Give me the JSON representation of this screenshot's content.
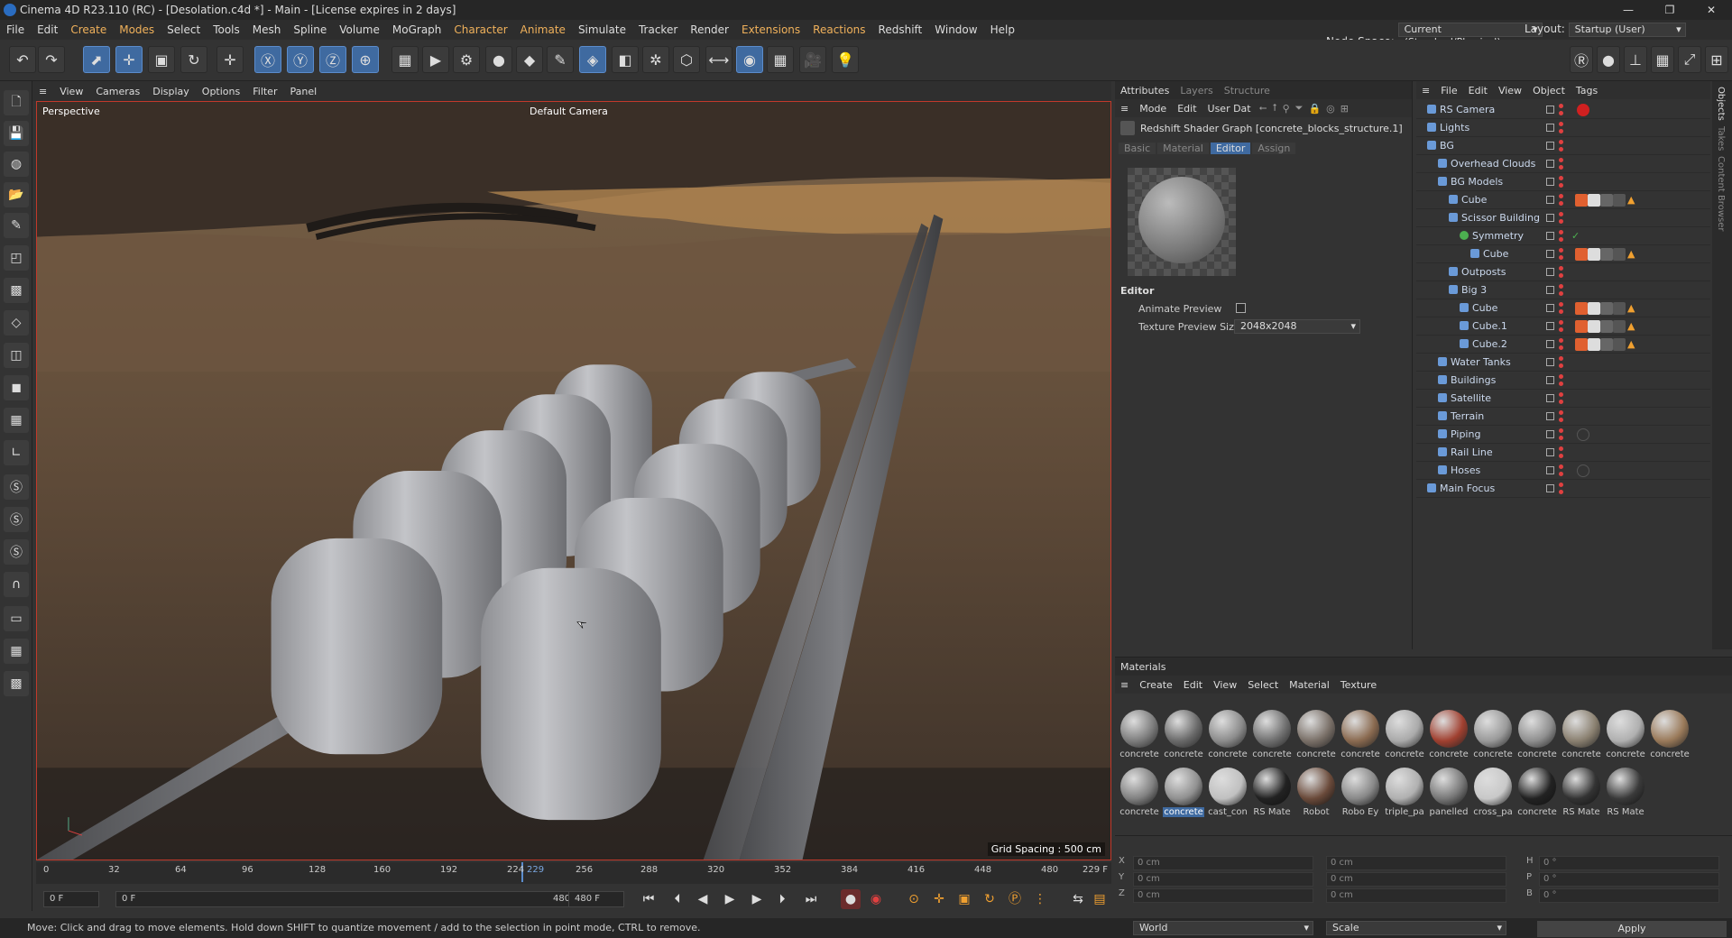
{
  "window": {
    "title": "Cinema 4D R23.110 (RC) - [Desolation.c4d *] - Main - [License expires in 2 days]",
    "min": "—",
    "max": "❐",
    "close": "✕"
  },
  "menu": [
    "File",
    "Edit",
    "Create",
    "Modes",
    "Select",
    "Tools",
    "Mesh",
    "Spline",
    "Volume",
    "MoGraph",
    "Character",
    "Animate",
    "Simulate",
    "Tracker",
    "Render",
    "Extensions",
    "Reactions",
    "Redshift",
    "Window",
    "Help"
  ],
  "nodespace": {
    "label": "Node Space:",
    "value": "Current (Standard/Physical)"
  },
  "layout": {
    "label": "Layout:",
    "value": "Startup (User)"
  },
  "viewport": {
    "menu": [
      "View",
      "Cameras",
      "Display",
      "Options",
      "Filter",
      "Panel"
    ],
    "label": "Perspective",
    "camera": "Default Camera",
    "grid": "Grid Spacing : 500 cm"
  },
  "timeline": {
    "ticks": [
      "0",
      "32",
      "64",
      "96",
      "128",
      "160",
      "192",
      "224",
      "229",
      "256",
      "288",
      "320",
      "352",
      "384",
      "416",
      "448",
      "480"
    ],
    "current": "229 F"
  },
  "transport": {
    "start": "0 F",
    "range_start": "0 F",
    "range_end": "480 F",
    "end": "480 F",
    "end2": "480 F"
  },
  "status": "Move: Click and drag to move elements. Hold down SHIFT to quantize movement / add to the selection in point mode, CTRL to remove.",
  "attributes": {
    "tabs": [
      "Attributes",
      "Layers",
      "Structure"
    ],
    "bar": [
      "Mode",
      "Edit",
      "User Dat"
    ],
    "title": "Redshift Shader Graph [concrete_blocks_structure.1]",
    "subtabs": [
      "Basic",
      "Material",
      "Editor",
      "Assign"
    ],
    "section": "Editor",
    "animate_label": "Animate Preview",
    "tex_label": "Texture Preview Size",
    "tex_value": "2048x2048"
  },
  "objects": {
    "menu": [
      "File",
      "Edit",
      "View",
      "Object",
      "Tags"
    ],
    "items": [
      {
        "name": "RS Camera",
        "depth": 0
      },
      {
        "name": "Lights",
        "depth": 0
      },
      {
        "name": "BG",
        "depth": 0
      },
      {
        "name": "Overhead Clouds",
        "depth": 1
      },
      {
        "name": "BG Models",
        "depth": 1
      },
      {
        "name": "Cube",
        "depth": 2
      },
      {
        "name": "Scissor Building",
        "depth": 2
      },
      {
        "name": "Symmetry",
        "depth": 3
      },
      {
        "name": "Cube",
        "depth": 4
      },
      {
        "name": "Outposts",
        "depth": 2
      },
      {
        "name": "Big 3",
        "depth": 2
      },
      {
        "name": "Cube",
        "depth": 3
      },
      {
        "name": "Cube.1",
        "depth": 3
      },
      {
        "name": "Cube.2",
        "depth": 3
      },
      {
        "name": "Water Tanks",
        "depth": 1
      },
      {
        "name": "Buildings",
        "depth": 1
      },
      {
        "name": "Satellite",
        "depth": 1
      },
      {
        "name": "Terrain",
        "depth": 1
      },
      {
        "name": "Piping",
        "depth": 1
      },
      {
        "name": "Rail Line",
        "depth": 1
      },
      {
        "name": "Hoses",
        "depth": 1
      },
      {
        "name": "Main Focus",
        "depth": 0
      }
    ]
  },
  "side_tabs": [
    "Objects",
    "Takes",
    "Content Browser"
  ],
  "materials": {
    "title": "Materials",
    "menu": [
      "Create",
      "Edit",
      "View",
      "Select",
      "Material",
      "Texture"
    ],
    "row1": [
      "concrete",
      "concrete",
      "concrete",
      "concrete",
      "concrete",
      "concrete",
      "concrete",
      "concrete",
      "concrete",
      "concrete",
      "concrete",
      "concrete",
      "concrete"
    ],
    "row2": [
      "concrete",
      "concrete",
      "cast_con",
      "RS Mate",
      "Robot",
      "Robo Ey",
      "triple_pa",
      "panelled",
      "cross_pa",
      "concrete",
      "RS Mate",
      "RS Mate"
    ]
  },
  "coords": {
    "x": "X",
    "y": "Y",
    "z": "Z",
    "h": "H",
    "p": "P",
    "b": "B",
    "zero_cm": "0 cm",
    "zero_deg": "0 °",
    "world": "World",
    "scale": "Scale",
    "apply": "Apply"
  }
}
